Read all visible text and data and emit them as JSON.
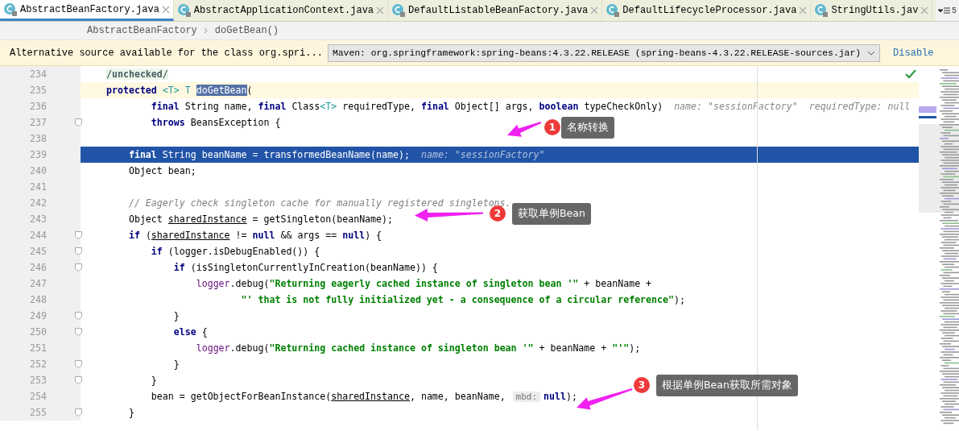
{
  "tabs": [
    {
      "label": "AbstractBeanFactory.java",
      "selected": true
    },
    {
      "label": "AbstractApplicationContext.java",
      "selected": false
    },
    {
      "label": "DefaultListableBeanFactory.java",
      "selected": false
    },
    {
      "label": "DefaultLifecycleProcessor.java",
      "selected": false
    },
    {
      "label": "StringUtils.jav",
      "selected": false
    }
  ],
  "tab_overflow": "5",
  "breadcrumb": [
    "AbstractBeanFactory",
    "doGetBean()"
  ],
  "banner": {
    "message": "Alternative source available for the class org.spri...",
    "source": "Maven: org.springframework:spring-beans:4.3.22.RELEASE (spring-beans-4.3.22.RELEASE-sources.jar)",
    "action": "Disable"
  },
  "code_lines": [
    {
      "number": "234",
      "current": false,
      "selected": false,
      "fold": false,
      "tokens": [
        {
          "kind": "annotation",
          "text": "/unchecked/"
        }
      ]
    },
    {
      "number": "235",
      "current": true,
      "selected": false,
      "fold": false,
      "tokens": [
        {
          "kind": "keyword",
          "text": "protected"
        },
        {
          "kind": "typeparam",
          "text": " <T>"
        },
        {
          "kind": "typeparam",
          "text": " T"
        },
        {
          "kind": "match",
          "text": " doGetBean"
        },
        {
          "kind": "plain",
          "text": "("
        }
      ]
    },
    {
      "number": "236",
      "current": false,
      "selected": false,
      "fold": false,
      "tokens": [
        {
          "kind": "keyword",
          "text": "        final"
        },
        {
          "kind": "plain",
          "text": " String name, "
        },
        {
          "kind": "keyword",
          "text": "final"
        },
        {
          "kind": "plain",
          "text": " Class"
        },
        {
          "kind": "typeparam",
          "text": "<T>"
        },
        {
          "kind": "plain",
          "text": " requiredType, "
        },
        {
          "kind": "keyword",
          "text": "final"
        },
        {
          "kind": "plain",
          "text": " Object[] args, "
        },
        {
          "kind": "keyword",
          "text": "boolean"
        },
        {
          "kind": "plain",
          "text": " typeCheckOnly)"
        },
        {
          "kind": "hint",
          "text": "name: \"sessionFactory\""
        },
        {
          "kind": "hint",
          "text": "requiredType: null"
        }
      ]
    },
    {
      "number": "237",
      "current": false,
      "selected": false,
      "fold": true,
      "tokens": [
        {
          "kind": "keyword",
          "text": "        throws"
        },
        {
          "kind": "plain",
          "text": " BeansException {"
        }
      ]
    },
    {
      "number": "238",
      "current": false,
      "selected": false,
      "fold": false
    },
    {
      "number": "239",
      "current": false,
      "selected": true,
      "fold": false,
      "tokens": [
        {
          "kind": "keyword",
          "text": "    final"
        },
        {
          "kind": "plain",
          "text": " String beanName = transformedBeanName(name);"
        },
        {
          "kind": "hint",
          "text": "name: \"sessionFactory\""
        }
      ]
    },
    {
      "number": "240",
      "current": false,
      "selected": false,
      "fold": false,
      "tokens": [
        {
          "kind": "plain",
          "text": "    Object bean;"
        }
      ]
    },
    {
      "number": "241",
      "current": false,
      "selected": false,
      "fold": false
    },
    {
      "number": "242",
      "current": false,
      "selected": false,
      "fold": false,
      "tokens": [
        {
          "kind": "comment",
          "text": "    // Eagerly check singleton cache for manually registered singletons."
        }
      ]
    },
    {
      "number": "243",
      "current": false,
      "selected": false,
      "fold": false,
      "tokens": [
        {
          "kind": "plain",
          "text": "    Object "
        },
        {
          "kind": "underlined",
          "text": "sharedInstance"
        },
        {
          "kind": "plain",
          "text": " = getSingleton(beanName);"
        }
      ]
    },
    {
      "number": "244",
      "current": false,
      "selected": false,
      "fold": true,
      "tokens": [
        {
          "kind": "keyword",
          "text": "    if"
        },
        {
          "kind": "plain",
          "text": " ("
        },
        {
          "kind": "underlined",
          "text": "sharedInstance"
        },
        {
          "kind": "plain",
          "text": " != "
        },
        {
          "kind": "keyword",
          "text": "null"
        },
        {
          "kind": "plain",
          "text": " && args == "
        },
        {
          "kind": "keyword",
          "text": "null"
        },
        {
          "kind": "plain",
          "text": ") {"
        }
      ]
    },
    {
      "number": "245",
      "current": false,
      "selected": false,
      "fold": true,
      "tokens": [
        {
          "kind": "keyword",
          "text": "        if"
        },
        {
          "kind": "plain",
          "text": " (logger.isDebugEnabled()) {"
        }
      ]
    },
    {
      "number": "246",
      "current": false,
      "selected": false,
      "fold": true,
      "tokens": [
        {
          "kind": "keyword",
          "text": "            if"
        },
        {
          "kind": "plain",
          "text": " (isSingletonCurrentlyInCreation(beanName)) {"
        }
      ]
    },
    {
      "number": "247",
      "current": false,
      "selected": false,
      "fold": false,
      "tokens": [
        {
          "kind": "field",
          "text": "                logger"
        },
        {
          "kind": "plain",
          "text": ".debug("
        },
        {
          "kind": "string",
          "text": "\"Returning eagerly cached instance of singleton bean '\""
        },
        {
          "kind": "plain",
          "text": " + beanName +"
        }
      ]
    },
    {
      "number": "248",
      "current": false,
      "selected": false,
      "fold": false,
      "tokens": [
        {
          "kind": "string",
          "text": "                        \"' that is not fully initialized yet - a consequence of a circular reference\""
        },
        {
          "kind": "plain",
          "text": ");"
        }
      ]
    },
    {
      "number": "249",
      "current": false,
      "selected": false,
      "fold": true,
      "tokens": [
        {
          "kind": "plain",
          "text": "            }"
        }
      ]
    },
    {
      "number": "250",
      "current": false,
      "selected": false,
      "fold": true,
      "tokens": [
        {
          "kind": "keyword",
          "text": "            else"
        },
        {
          "kind": "plain",
          "text": " {"
        }
      ]
    },
    {
      "number": "251",
      "current": false,
      "selected": false,
      "fold": false,
      "tokens": [
        {
          "kind": "field",
          "text": "                logger"
        },
        {
          "kind": "plain",
          "text": ".debug("
        },
        {
          "kind": "string",
          "text": "\"Returning cached instance of singleton bean '\""
        },
        {
          "kind": "plain",
          "text": " + beanName + "
        },
        {
          "kind": "string",
          "text": "\"'\""
        },
        {
          "kind": "plain",
          "text": ");"
        }
      ]
    },
    {
      "number": "252",
      "current": false,
      "selected": false,
      "fold": true,
      "tokens": [
        {
          "kind": "plain",
          "text": "            }"
        }
      ]
    },
    {
      "number": "253",
      "current": false,
      "selected": false,
      "fold": true,
      "tokens": [
        {
          "kind": "plain",
          "text": "        }"
        }
      ]
    },
    {
      "number": "254",
      "current": false,
      "selected": false,
      "fold": false,
      "tokens": [
        {
          "kind": "plain",
          "text": "        bean = getObjectForBeanInstance("
        },
        {
          "kind": "underlined",
          "text": "sharedInstance"
        },
        {
          "kind": "plain",
          "text": ", name, beanName, "
        },
        {
          "kind": "chip",
          "text": "mbd:"
        },
        {
          "kind": "keyword",
          "text": "null"
        },
        {
          "kind": "plain",
          "text": ");"
        }
      ]
    },
    {
      "number": "255",
      "current": false,
      "selected": false,
      "fold": true,
      "tokens": [
        {
          "kind": "plain",
          "text": "    }"
        }
      ]
    }
  ],
  "callouts": [
    {
      "number": "1",
      "label": "名称转换"
    },
    {
      "number": "2",
      "label": "获取单例Bean"
    },
    {
      "number": "3",
      "label": "根据单例Bean获取所需对象"
    }
  ]
}
